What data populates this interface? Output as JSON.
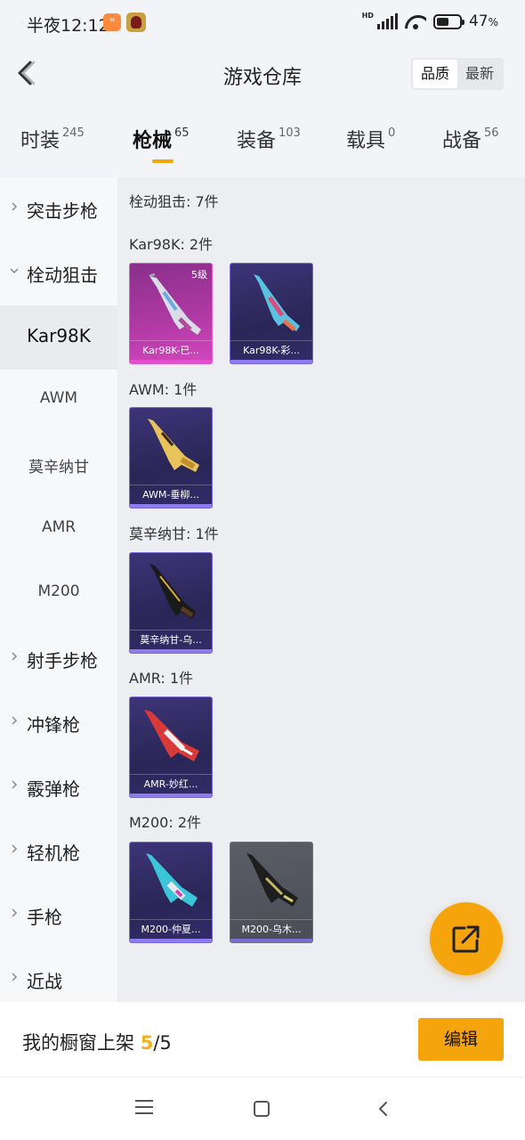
{
  "status_bar": {
    "time": "半夜12:12",
    "app_icon_1": "mi-store-icon",
    "app_icon_2": "helmet-app-icon",
    "hd_label": "HD",
    "battery_value": "47",
    "battery_unit": "%"
  },
  "header": {
    "title": "游戏仓库",
    "sort_options": [
      "品质",
      "最新"
    ],
    "active_sort": "品质"
  },
  "category_tabs": [
    {
      "label": "时装",
      "count": "245"
    },
    {
      "label": "枪械",
      "count": "65",
      "active": true
    },
    {
      "label": "装备",
      "count": "103"
    },
    {
      "label": "载具",
      "count": "0"
    },
    {
      "label": "战备",
      "count": "56"
    }
  ],
  "sidebar": [
    {
      "label": "突击步枪"
    },
    {
      "label": "栓动狙击"
    },
    {
      "label": "Kar98K"
    },
    {
      "label": "AWM"
    },
    {
      "label": "莫辛纳甘"
    },
    {
      "label": "AMR"
    },
    {
      "label": "M200"
    },
    {
      "label": "射手步枪"
    },
    {
      "label": "冲锋枪"
    },
    {
      "label": "霰弹枪"
    },
    {
      "label": "轻机枪"
    },
    {
      "label": "手枪"
    },
    {
      "label": "近战"
    }
  ],
  "content": {
    "summary": "栓动狙击: 7件",
    "sections": [
      {
        "label": "Kar98K: 2件",
        "items": [
          {
            "name": "Kar98K-已...",
            "level": "5级",
            "rarity": "pink"
          },
          {
            "name": "Kar98K-彩...",
            "rarity": "purple"
          }
        ]
      },
      {
        "label": "AWM: 1件",
        "items": [
          {
            "name": "AWM-垂柳...",
            "rarity": "purple"
          }
        ]
      },
      {
        "label": "莫辛纳甘: 1件",
        "items": [
          {
            "name": "莫辛纳甘-乌...",
            "rarity": "purple"
          }
        ]
      },
      {
        "label": "AMR: 1件",
        "items": [
          {
            "name": "AMR-妙红...",
            "rarity": "purple"
          }
        ]
      },
      {
        "label": "M200: 2件",
        "items": [
          {
            "name": "M200-仲夏...",
            "rarity": "purple"
          },
          {
            "name": "M200-乌木...",
            "rarity": "gray"
          }
        ]
      }
    ]
  },
  "fab": {
    "icon": "share-external-icon"
  },
  "bottom_bar": {
    "showcase_label": "我的橱窗上架",
    "showcase_current": "5",
    "showcase_total": "/5",
    "edit_label": "编辑"
  },
  "colors": {
    "accent": "#f5a40c",
    "pink_rarity": "#d447bd",
    "purple_rarity": "#8e7bf0"
  }
}
